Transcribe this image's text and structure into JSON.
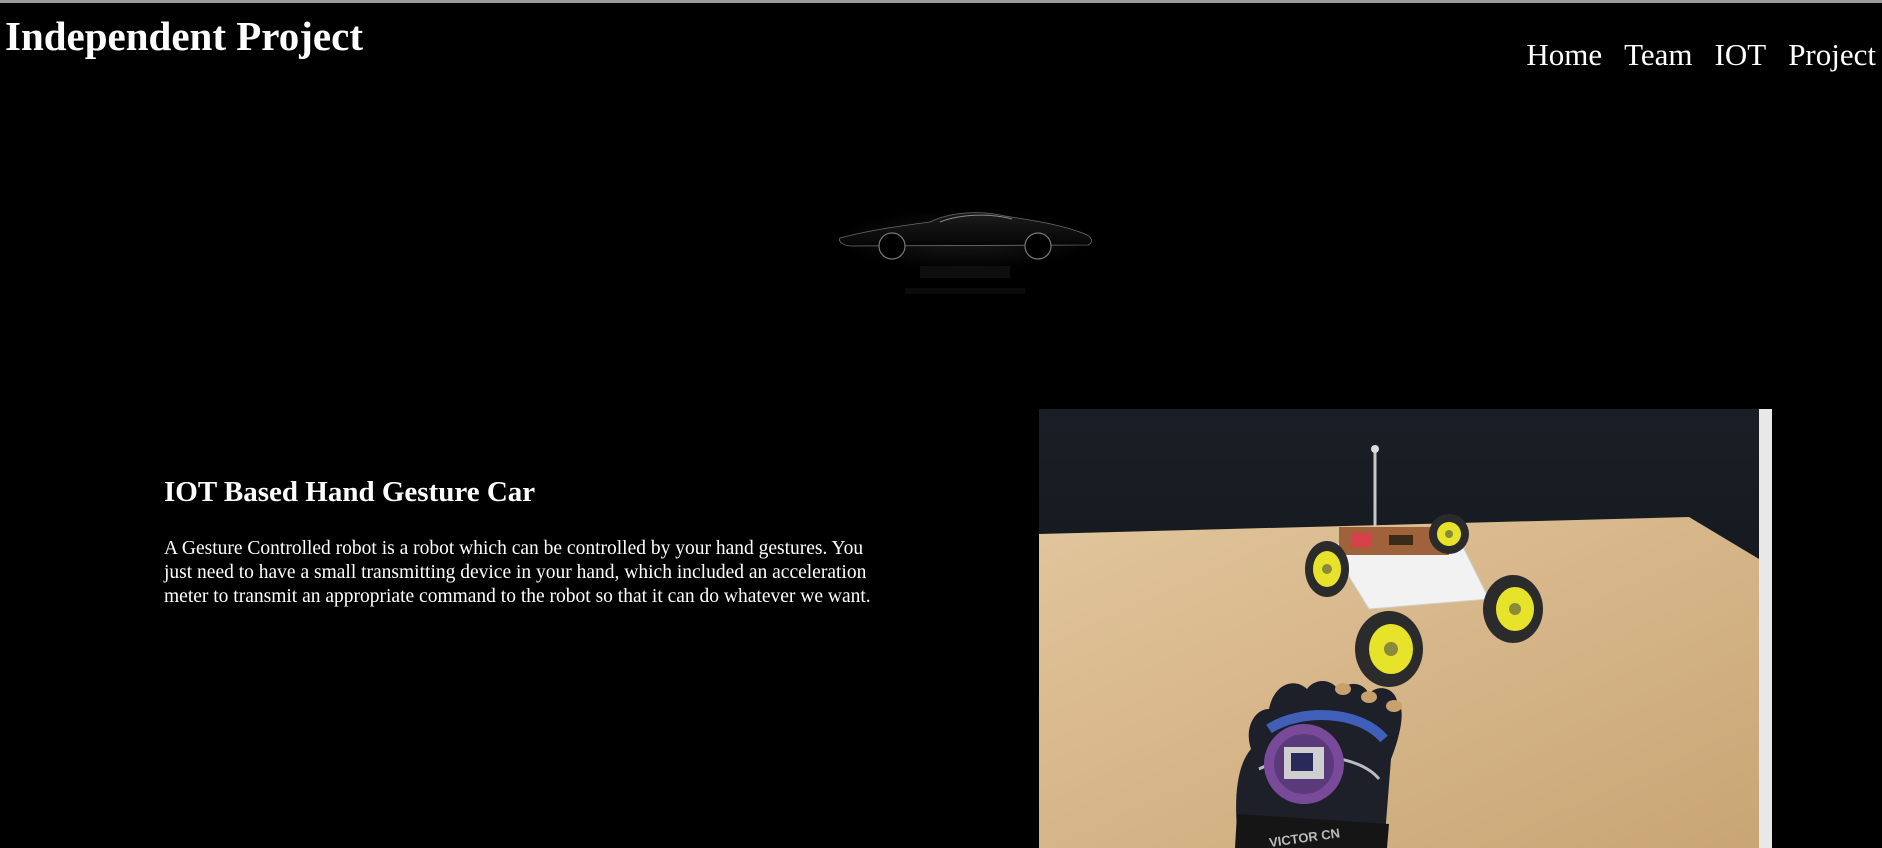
{
  "header": {
    "site_title": "Independent Project",
    "nav": [
      {
        "label": "Home"
      },
      {
        "label": "Team"
      },
      {
        "label": "IOT"
      },
      {
        "label": "Project"
      }
    ]
  },
  "hero": {
    "logo_icon": "sports-car-silhouette-icon"
  },
  "content": {
    "heading": "IOT Based Hand Gesture Car",
    "paragraph": "A Gesture Controlled robot is a robot which can be controlled by your hand gestures. You just need to have a small transmitting device in your hand, which included an acceleration meter to transmit an appropriate command to the robot so that it can do whatever we want."
  },
  "photo": {
    "subject": "gesture-controlled robot car with glove transmitter",
    "glove_print": "VICTOR CN"
  },
  "colors": {
    "background": "#000000",
    "text": "#ffffff",
    "wheel": "#e6e32a",
    "table": "#d9b98c"
  }
}
